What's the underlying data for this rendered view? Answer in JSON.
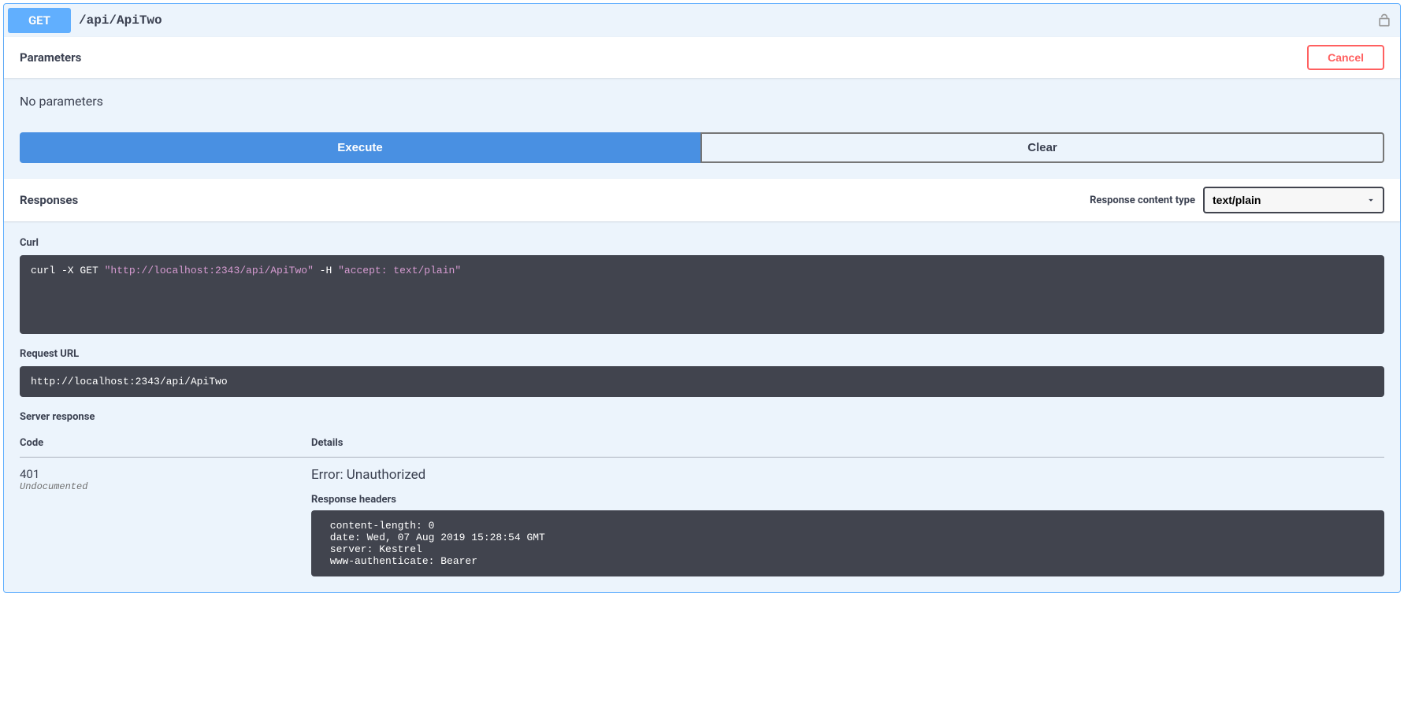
{
  "summary": {
    "method": "GET",
    "path": "/api/ApiTwo"
  },
  "parameters": {
    "title": "Parameters",
    "cancel": "Cancel",
    "empty": "No parameters"
  },
  "buttons": {
    "execute": "Execute",
    "clear": "Clear"
  },
  "responses": {
    "title": "Responses",
    "content_type_label": "Response content type",
    "content_type_value": "text/plain"
  },
  "curl": {
    "label": "Curl",
    "prefix": "curl -X GET ",
    "url": "\"http://localhost:2343/api/ApiTwo\"",
    "mid": " -H ",
    "accept": "\"accept: text/plain\""
  },
  "request_url": {
    "label": "Request URL",
    "value": "http://localhost:2343/api/ApiTwo"
  },
  "server_response": {
    "label": "Server response",
    "code_header": "Code",
    "details_header": "Details",
    "code": "401",
    "undocumented": "Undocumented",
    "error": "Error: Unauthorized",
    "headers_title": "Response headers",
    "headers_text": " content-length: 0 \n date: Wed, 07 Aug 2019 15:28:54 GMT \n server: Kestrel \n www-authenticate: Bearer "
  }
}
